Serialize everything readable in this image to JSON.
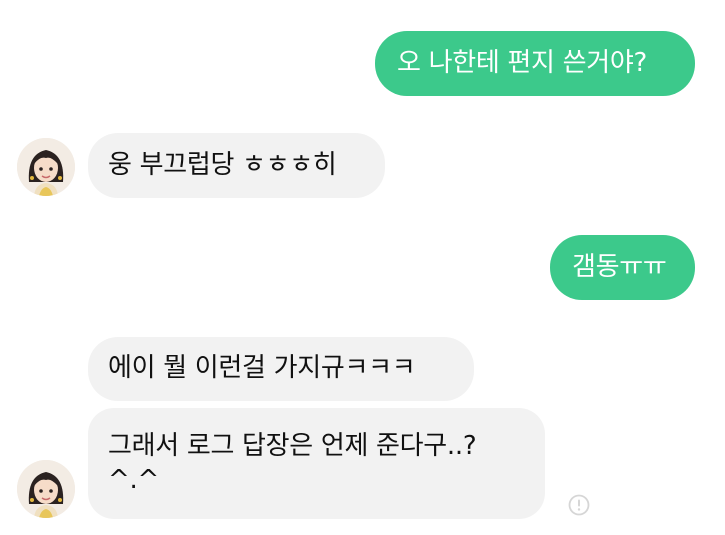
{
  "messages": [
    {
      "from": "me",
      "text": "오 나한테 편지 쓴거야?"
    },
    {
      "from": "them",
      "text": "웅 부끄럽당 ㅎㅎㅎ히"
    },
    {
      "from": "me",
      "text": "갬동ㅠㅠ"
    },
    {
      "from": "them",
      "text": "에이 뭘 이런걸 가지규ㅋㅋㅋ"
    },
    {
      "from": "them",
      "line1": "그래서 로그 답장은 언제 준다구..?",
      "line2": "^.^"
    }
  ],
  "colors": {
    "outgoing_bubble": "#3cc98b",
    "incoming_bubble": "#f2f2f2",
    "background": "#ffffff"
  },
  "icons": {
    "avatar": "girl-avatar-icon",
    "info": "info-circle-icon"
  }
}
